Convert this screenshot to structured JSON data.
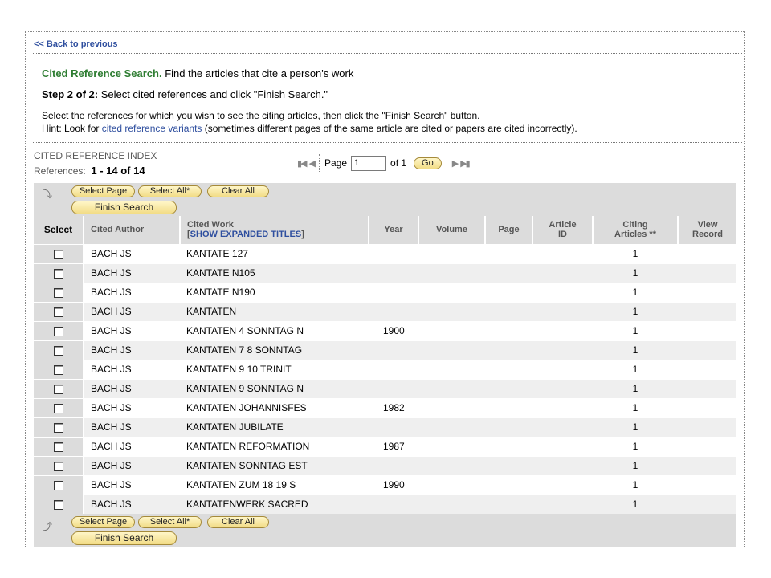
{
  "nav": {
    "back_label": "<< Back to previous"
  },
  "header": {
    "title_strong": "Cited Reference Search.",
    "title_rest": " Find the articles that cite a person's work",
    "step_strong": "Step 2 of 2:",
    "step_rest": " Select cited references and click \"Finish Search.\"",
    "instruction": "Select the references for which you wish to see the citing articles, then click the \"Finish Search\" button.",
    "hint_prefix": "Hint: Look for ",
    "hint_link": "cited reference variants",
    "hint_suffix": " (sometimes different pages of the same article are cited or papers are cited incorrectly)."
  },
  "index": {
    "label": "CITED REFERENCE INDEX",
    "refs_label": "References:",
    "refs_range": "1 - 14 of  14"
  },
  "pager": {
    "page_label": "Page",
    "page_value": "1",
    "of_label": "of 1",
    "go_label": "Go"
  },
  "toolbar": {
    "select_page": "Select Page",
    "select_all": "Select All*",
    "clear_all": "Clear All",
    "finish_search": "Finish Search"
  },
  "table": {
    "headers": {
      "select": "Select",
      "cited_author": "Cited Author",
      "cited_work": "Cited Work",
      "show_expanded_pre": "[",
      "show_expanded": "SHOW EXPANDED TITLES",
      "show_expanded_post": "]",
      "year": "Year",
      "volume": "Volume",
      "page": "Page",
      "article_id_1": "Article",
      "article_id_2": "ID",
      "citing_1": "Citing",
      "citing_2": "Articles **",
      "view_1": "View",
      "view_2": "Record"
    },
    "rows": [
      {
        "author": "BACH JS",
        "work": "KANTATE 127",
        "year": "",
        "volume": "",
        "page": "",
        "article_id": "",
        "citing": "1"
      },
      {
        "author": "BACH JS",
        "work": "KANTATE N105",
        "year": "",
        "volume": "",
        "page": "",
        "article_id": "",
        "citing": "1"
      },
      {
        "author": "BACH JS",
        "work": "KANTATE N190",
        "year": "",
        "volume": "",
        "page": "",
        "article_id": "",
        "citing": "1"
      },
      {
        "author": "BACH JS",
        "work": "KANTATEN",
        "year": "",
        "volume": "",
        "page": "",
        "article_id": "",
        "citing": "1"
      },
      {
        "author": "BACH JS",
        "work": "KANTATEN 4 SONNTAG N",
        "year": "1900",
        "volume": "",
        "page": "",
        "article_id": "",
        "citing": "1"
      },
      {
        "author": "BACH JS",
        "work": "KANTATEN 7 8 SONNTAG",
        "year": "",
        "volume": "",
        "page": "",
        "article_id": "",
        "citing": "1"
      },
      {
        "author": "BACH JS",
        "work": "KANTATEN 9 10 TRINIT",
        "year": "",
        "volume": "",
        "page": "",
        "article_id": "",
        "citing": "1"
      },
      {
        "author": "BACH JS",
        "work": "KANTATEN 9 SONNTAG N",
        "year": "",
        "volume": "",
        "page": "",
        "article_id": "",
        "citing": "1"
      },
      {
        "author": "BACH JS",
        "work": "KANTATEN JOHANNISFES",
        "year": "1982",
        "volume": "",
        "page": "",
        "article_id": "",
        "citing": "1"
      },
      {
        "author": "BACH JS",
        "work": "KANTATEN JUBILATE",
        "year": "",
        "volume": "",
        "page": "",
        "article_id": "",
        "citing": "1"
      },
      {
        "author": "BACH JS",
        "work": "KANTATEN REFORMATION",
        "year": "1987",
        "volume": "",
        "page": "",
        "article_id": "",
        "citing": "1"
      },
      {
        "author": "BACH JS",
        "work": "KANTATEN SONNTAG EST",
        "year": "",
        "volume": "",
        "page": "",
        "article_id": "",
        "citing": "1"
      },
      {
        "author": "BACH JS",
        "work": "KANTATEN ZUM 18 19 S",
        "year": "1990",
        "volume": "",
        "page": "",
        "article_id": "",
        "citing": "1"
      },
      {
        "author": "BACH JS",
        "work": "KANTATENWERK SACRED",
        "year": "",
        "volume": "",
        "page": "",
        "article_id": "",
        "citing": "1"
      }
    ]
  },
  "colors": {
    "title_green": "#2e7d32",
    "link_blue": "#2f4f9f",
    "toolbar_gray": "#dcdcdc",
    "button_gold": "#f2dc86"
  },
  "icons": {
    "first_page": "first-page-icon",
    "prev_page": "prev-page-icon",
    "next_page": "next-page-icon",
    "last_page": "last-page-icon",
    "arrow_down": "arrow-down-icon",
    "arrow_up": "arrow-up-icon"
  }
}
